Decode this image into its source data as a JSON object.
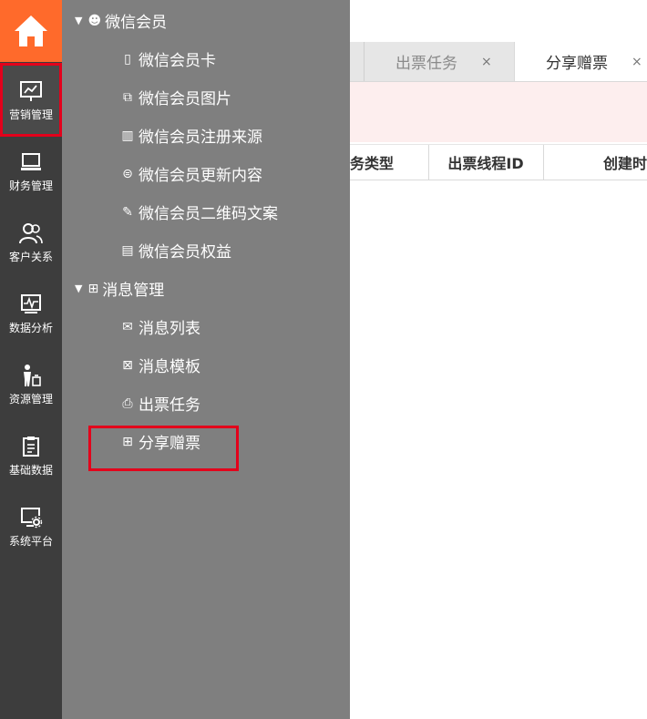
{
  "rail": {
    "items": [
      {
        "label": "营销管理",
        "icon": "presentation-chart-icon"
      },
      {
        "label": "财务管理",
        "icon": "laptop-icon"
      },
      {
        "label": "客户关系",
        "icon": "users-icon"
      },
      {
        "label": "数据分析",
        "icon": "monitor-chart-icon"
      },
      {
        "label": "资源管理",
        "icon": "person-luggage-icon"
      },
      {
        "label": "基础数据",
        "icon": "clipboard-icon"
      },
      {
        "label": "系统平台",
        "icon": "screen-gear-icon"
      }
    ]
  },
  "submenu": {
    "group1": {
      "label": "微信会员",
      "icon": "users-small-icon"
    },
    "group1_items": [
      {
        "label": "微信会员卡",
        "icon": "card-icon"
      },
      {
        "label": "微信会员图片",
        "icon": "images-icon"
      },
      {
        "label": "微信会员注册来源",
        "icon": "book-icon"
      },
      {
        "label": "微信会员更新内容",
        "icon": "refresh-doc-icon"
      },
      {
        "label": "微信会员二维码文案",
        "icon": "edit-doc-icon"
      },
      {
        "label": "微信会员权益",
        "icon": "list-doc-icon"
      }
    ],
    "group2": {
      "label": "消息管理",
      "icon": "grid-icon"
    },
    "group2_items": [
      {
        "label": "消息列表",
        "icon": "envelope-open-icon"
      },
      {
        "label": "消息模板",
        "icon": "envelope-icon"
      },
      {
        "label": "出票任务",
        "icon": "printer-icon"
      },
      {
        "label": "分享赠票",
        "icon": "grid-icon"
      }
    ]
  },
  "tabs": [
    {
      "label": "出票任务",
      "close": "×"
    },
    {
      "label": "分享赠票",
      "close": "×"
    }
  ],
  "table": {
    "headers": [
      "务类型",
      "出票线程ID",
      "创建时"
    ]
  },
  "colors": {
    "home": "#ff6a2b",
    "rail": "#3d3d3d",
    "submenu": "#7f7f7f",
    "highlight_border": "#e3001b"
  }
}
